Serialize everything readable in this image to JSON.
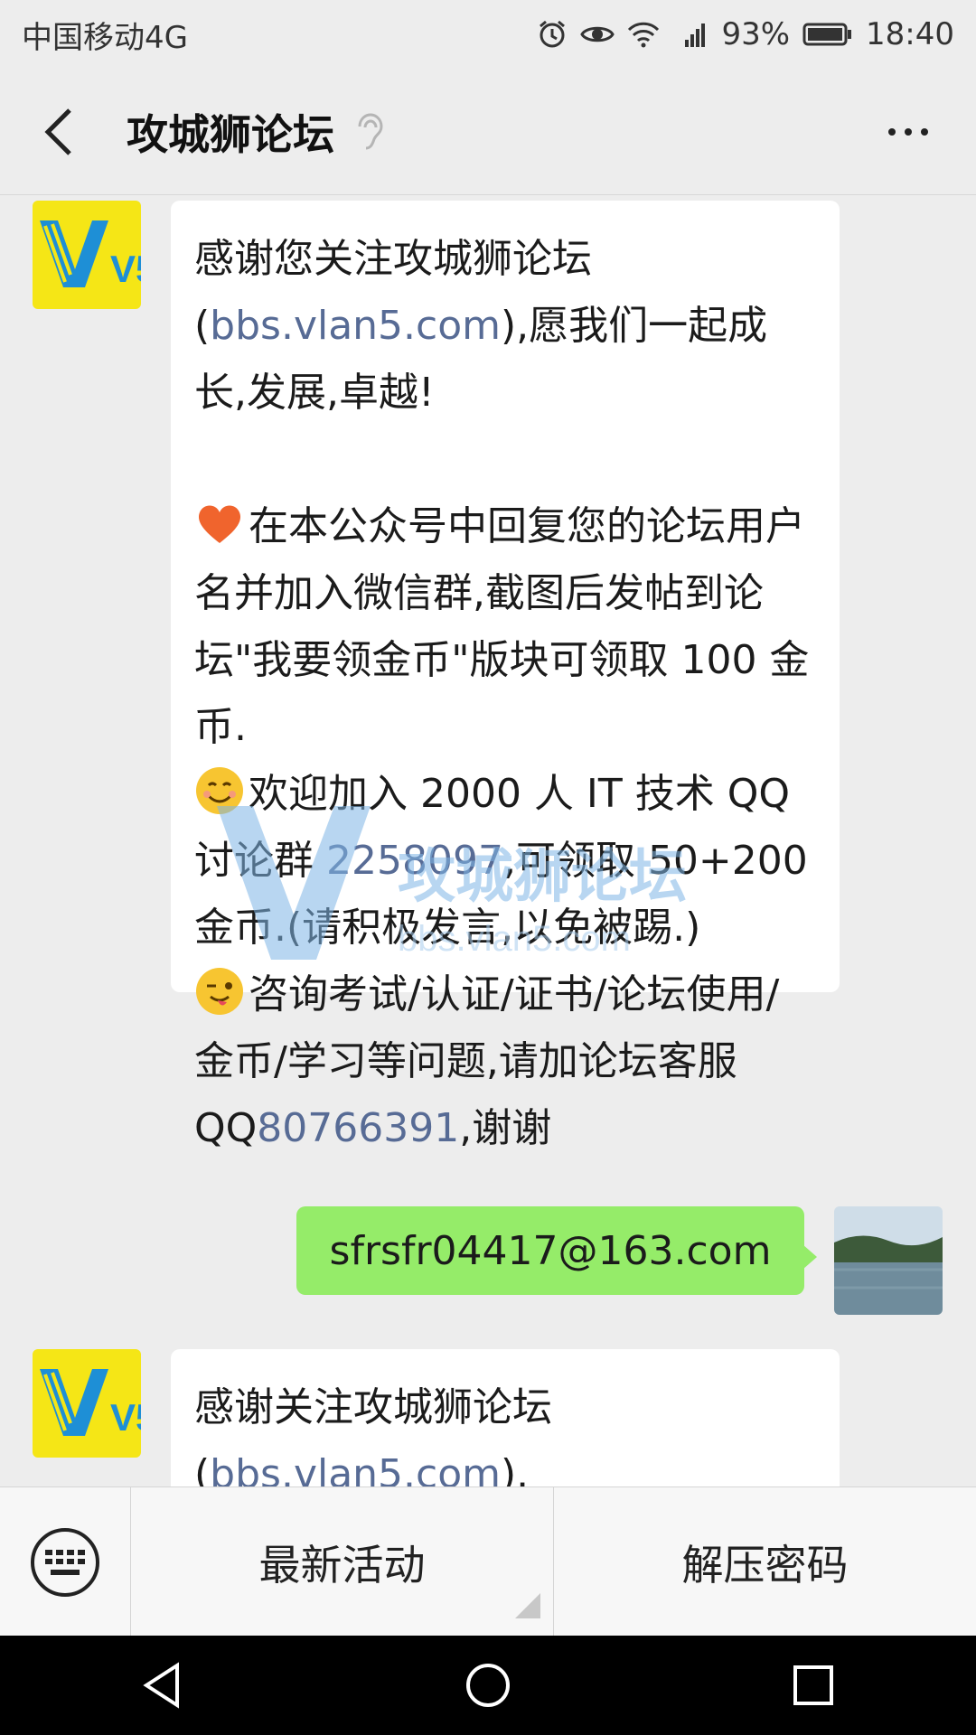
{
  "status_bar": {
    "carrier": "中国移动4G",
    "network": "4G",
    "battery": "93%",
    "time": "18:40"
  },
  "header": {
    "title": "攻城狮论坛"
  },
  "messages": [
    {
      "side": "received",
      "avatar_text": "V5",
      "parts": [
        {
          "text": "感谢您关注攻城狮论坛(",
          "link": false
        },
        {
          "text": "bbs.vlan5.com",
          "link": true
        },
        {
          "text": "),愿我们一起成长,发展,卓越!",
          "link": false
        },
        {
          "text": "在本公众号中回复您的论坛用户名并加入微信群,截图后发帖到论坛\"我要领金币\"版块可领取 100 金币.",
          "link": false
        },
        {
          "text": "欢迎加入 2000 人 IT 技术 QQ 讨论群 ",
          "link": false
        },
        {
          "text": "2258097",
          "link": true
        },
        {
          "text": ",可领取 50+200 金币.(请积极发言,以免被踢.)",
          "link": false
        },
        {
          "text": "咨询考试/认证/证书/论坛使用/金币/学习等问题,请加论坛客服 QQ",
          "link": false
        },
        {
          "text": "80766391",
          "link": true
        },
        {
          "text": ",谢谢",
          "link": false
        }
      ]
    },
    {
      "side": "sent",
      "text": "sfrsfr04417@163.com"
    },
    {
      "side": "received",
      "avatar_text": "V5",
      "parts": [
        {
          "text": "感谢关注攻城狮论坛(",
          "link": false
        },
        {
          "text": "bbs.vlan5.com",
          "link": true
        },
        {
          "text": ").",
          "link": false
        }
      ]
    }
  ],
  "watermark": {
    "text": "攻城狮论坛",
    "url": "bbs.vlan5.com"
  },
  "menu": {
    "items": [
      "最新活动",
      "解压密码"
    ]
  },
  "colors": {
    "background": "#ededed",
    "sent_bubble": "#95ec69",
    "link": "#576b95",
    "avatar_bg": "#f5e616",
    "avatar_fg": "#1e8fd6"
  },
  "icons": {
    "back": "back-arrow-icon",
    "ear": "ear-icon",
    "more": "more-icon",
    "keyboard": "keyboard-icon",
    "heart": "heart-emoji",
    "smile": "smile-emoji",
    "wink": "wink-emoji"
  }
}
